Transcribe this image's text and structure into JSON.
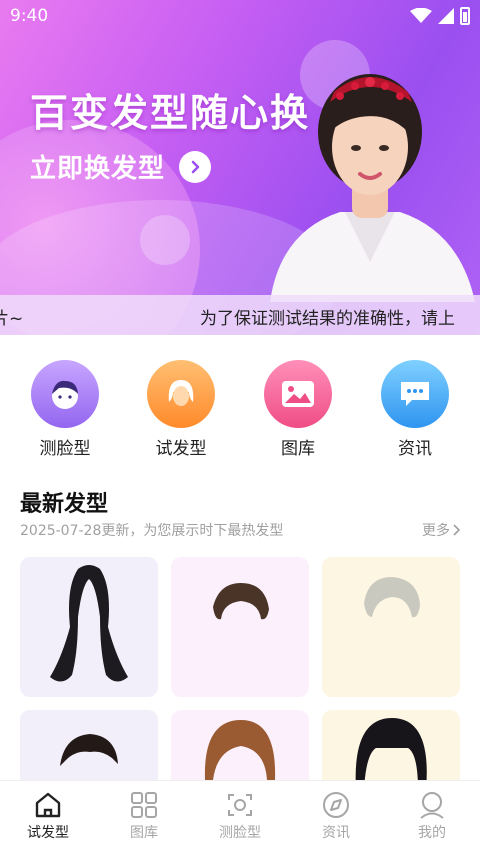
{
  "status_bar": {
    "time": "9:40"
  },
  "banner": {
    "title": "百变发型随心换",
    "cta": "立即换发型",
    "marquee_left": "片~",
    "marquee_right": "为了保证测试结果的准确性，请上"
  },
  "quick_entries": [
    {
      "label": "测脸型",
      "icon": "face-icon",
      "color": "#9b74f0"
    },
    {
      "label": "试发型",
      "icon": "hair-icon",
      "color": "#ff9a3c"
    },
    {
      "label": "图库",
      "icon": "image-icon",
      "color": "#f0609a"
    },
    {
      "label": "资讯",
      "icon": "chat-icon",
      "color": "#3ea6f5"
    }
  ],
  "section": {
    "title": "最新发型",
    "subtitle": "2025-07-28更新，为您展示时下最热发型",
    "more": "更多"
  },
  "tabbar": {
    "items": [
      {
        "label": "试发型",
        "icon": "home-icon",
        "active": true
      },
      {
        "label": "图库",
        "icon": "grid-icon",
        "active": false
      },
      {
        "label": "测脸型",
        "icon": "scan-icon",
        "active": false
      },
      {
        "label": "资讯",
        "icon": "compass-icon",
        "active": false
      },
      {
        "label": "我的",
        "icon": "user-icon",
        "active": false
      }
    ]
  },
  "colors": {
    "banner_start": "#e97bf0",
    "banner_end": "#9a4ff0",
    "active_tab": "#222222",
    "inactive_tab": "#a6a6a6"
  }
}
